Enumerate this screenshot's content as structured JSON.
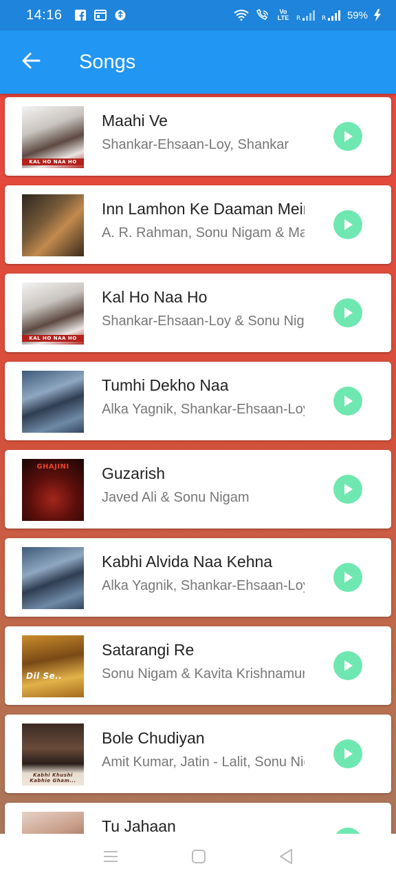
{
  "status_bar": {
    "time": "14:16",
    "battery": "59%",
    "volte_label": "Vo LTE",
    "icons": [
      "facebook-icon",
      "calendar-icon",
      "usb-icon",
      "wifi-icon",
      "wifi-calling-icon",
      "volte-icon",
      "signal-r-icon",
      "signal-r-icon",
      "battery-charging-icon"
    ]
  },
  "app_bar": {
    "title": "Songs",
    "back_icon": "arrow-left-icon"
  },
  "colors": {
    "status_bar": "#1f84db",
    "app_bar": "#2196f3",
    "background_top": "#e8473d",
    "background_bottom": "#a8765a",
    "play_button": "#6fe7b1"
  },
  "songs": [
    {
      "title": "Maahi Ve",
      "artist": "Shankar-Ehsaan-Loy, Shankar",
      "art": "Kal Ho Naa Ho album art",
      "art_caption": "KAL HO NAA HO"
    },
    {
      "title": "Inn Lamhon Ke Daaman Mein",
      "artist": "A. R. Rahman, Sonu Nigam & Madhushree",
      "art": "Jodhaa Akbar album art",
      "art_caption": ""
    },
    {
      "title": "Kal Ho Naa Ho",
      "artist": "Shankar-Ehsaan-Loy & Sonu Nigam",
      "art": "Kal Ho Naa Ho album art",
      "art_caption": "KAL HO NAA HO"
    },
    {
      "title": "Tumhi Dekho Naa",
      "artist": "Alka Yagnik, Shankar-Ehsaan-Loy",
      "art": "Kabhi Alvida Naa Kehna album art",
      "art_caption": ""
    },
    {
      "title": "Guzarish",
      "artist": "Javed Ali & Sonu Nigam",
      "art": "Ghajini album art",
      "art_caption": "GHAJINI"
    },
    {
      "title": "Kabhi Alvida Naa Kehna",
      "artist": "Alka Yagnik, Shankar-Ehsaan-Loy",
      "art": "Kabhi Alvida Naa Kehna album art",
      "art_caption": ""
    },
    {
      "title": "Satarangi Re",
      "artist": "Sonu Nigam & Kavita Krishnamurthy",
      "art": "Dil Se album art",
      "art_caption": "Dil Se.."
    },
    {
      "title": "Bole Chudiyan",
      "artist": "Amit Kumar, Jatin - Lalit, Sonu Nigam",
      "art": "Kabhi Khushi Kabhie Gham album art",
      "art_caption": "Kabhi Khushi Kabhie Gham..."
    },
    {
      "title": "Tu Jahaan",
      "artist": "",
      "art": "album art",
      "art_caption": ""
    }
  ],
  "nav_bar": {
    "buttons": [
      "menu-icon",
      "home-icon",
      "back-triangle-icon"
    ]
  }
}
